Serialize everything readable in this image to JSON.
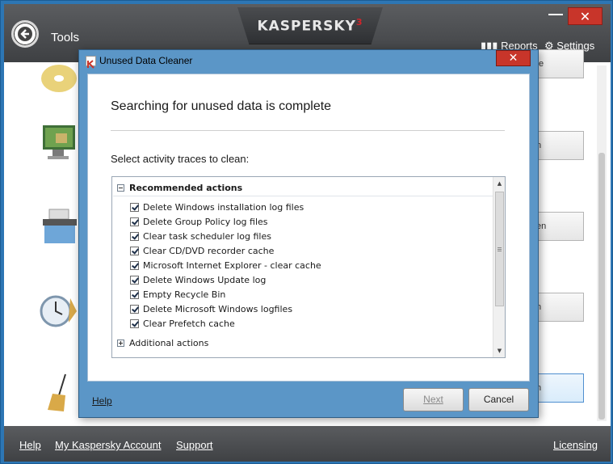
{
  "main": {
    "title": "Tools",
    "brand": "KASPERSKY",
    "brand_mark": "3",
    "reports_label": "Reports",
    "settings_label": "Settings",
    "close_glyph": "✕",
    "tool_button_fragments": [
      "te",
      "n",
      "en",
      "n",
      "n"
    ]
  },
  "footer": {
    "help": "Help",
    "account": "My Kaspersky Account",
    "support": "Support",
    "licensing": "Licensing"
  },
  "dialog": {
    "title": "Unused Data Cleaner",
    "close_glyph": "✕",
    "heading": "Searching for unused data is complete",
    "subheading": "Select activity traces to clean:",
    "groups": {
      "recommended": "Recommended actions",
      "additional": "Additional actions"
    },
    "items": [
      "Delete Windows installation log files",
      "Delete Group Policy log files",
      "Clear task scheduler log files",
      "Clear CD/DVD recorder cache",
      "Microsoft Internet Explorer - clear cache",
      "Delete Windows Update log",
      "Empty Recycle Bin",
      "Delete Microsoft Windows logfiles",
      "Clear Prefetch cache"
    ],
    "help": "Help",
    "next": "Next",
    "cancel": "Cancel"
  }
}
